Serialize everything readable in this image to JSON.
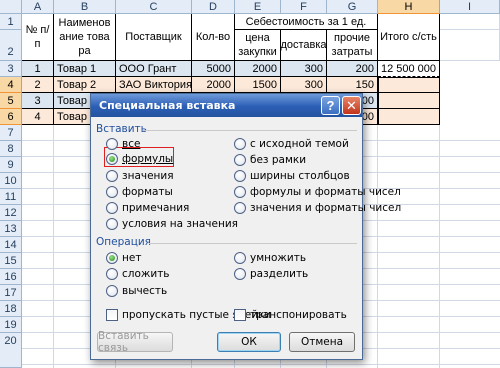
{
  "columns": [
    "A",
    "B",
    "C",
    "D",
    "E",
    "F",
    "G",
    "H",
    "I"
  ],
  "rows": [
    "1",
    "2",
    "3",
    "4",
    "5",
    "6",
    "7",
    "8",
    "9",
    "10",
    "11",
    "12",
    "13",
    "14",
    "15",
    "16",
    "17",
    "18",
    "19",
    "20"
  ],
  "header": {
    "num": "№ п/п",
    "name": "Наименование товара",
    "supplier": "Поставщик",
    "qty": "Кол-во",
    "cost_group": "Себестоимость за 1 ед.",
    "price": "цена закупки",
    "delivery": "доставка",
    "other": "прочие затраты",
    "total": "Итого с/сть"
  },
  "data_rows": [
    {
      "num": "1",
      "name": "Товар 1",
      "supplier": "ООО Грант",
      "qty": "5000",
      "price": "2000",
      "delivery": "300",
      "other": "200",
      "total": "12 500 000"
    },
    {
      "num": "2",
      "name": "Товар 2",
      "supplier": "ЗАО Виктория",
      "qty": "2000",
      "price": "1500",
      "delivery": "300",
      "other": "150",
      "total": ""
    },
    {
      "num": "3",
      "name": "Товар 3",
      "supplier": "",
      "qty": "",
      "price": "",
      "delivery": "",
      "other": "00",
      "total": ""
    },
    {
      "num": "4",
      "name": "Товар 4",
      "supplier": "",
      "qty": "",
      "price": "",
      "delivery": "",
      "other": "00",
      "total": ""
    }
  ],
  "dialog": {
    "title": "Специальная вставка",
    "help": "?",
    "close": "✕",
    "paste_group": "Вставить",
    "paste_left": [
      "все",
      "формулы",
      "значения",
      "форматы",
      "примечания",
      "условия на значения"
    ],
    "paste_right": [
      "с исходной темой",
      "без рамки",
      "ширины столбцов",
      "формулы и форматы чисел",
      "значения и форматы чисел"
    ],
    "selected_paste": "формулы",
    "operation_group": "Операция",
    "op_left": [
      "нет",
      "сложить",
      "вычесть"
    ],
    "op_right": [
      "умножить",
      "разделить"
    ],
    "selected_operation": "нет",
    "skip_blanks": "пропускать пустые ячейки",
    "transpose": "транспонировать",
    "paste_link": "Вставить связь",
    "ok": "ОК",
    "cancel": "Отмена"
  },
  "colors": {
    "highlight": "#e02020",
    "title_bar": "#2b5eb5",
    "row_fill_peach": "#fde9d9",
    "row_fill_blue": "#dce6f1"
  }
}
